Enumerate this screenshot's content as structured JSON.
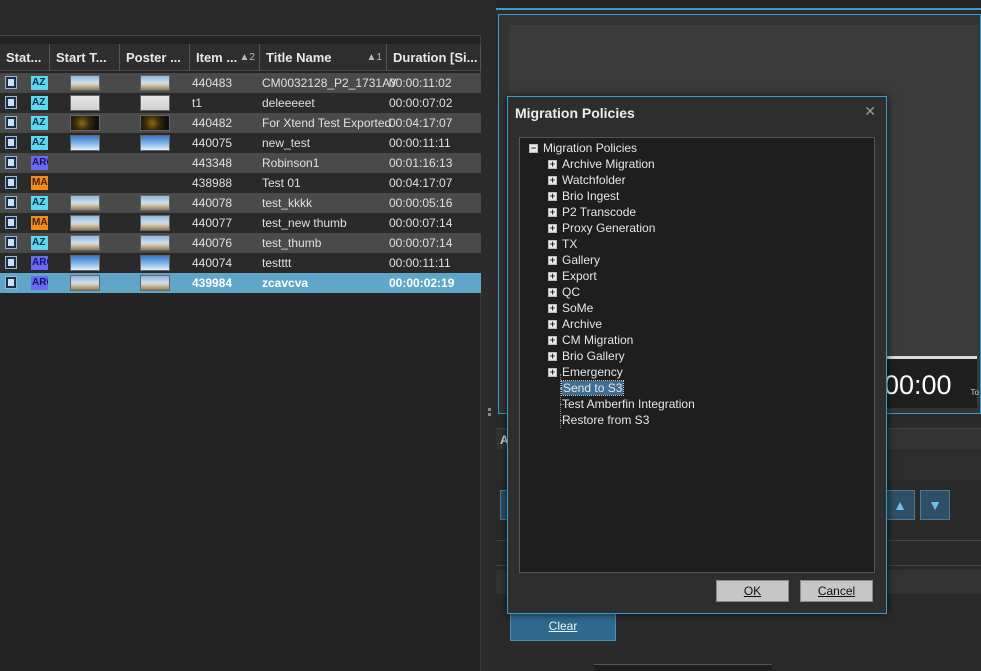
{
  "grid": {
    "columns": [
      {
        "label": "Stat...",
        "sort": ""
      },
      {
        "label": "Start T...",
        "sort": ""
      },
      {
        "label": "Poster ...",
        "sort": ""
      },
      {
        "label": "Item ...",
        "sort": "▲2"
      },
      {
        "label": "Title Name",
        "sort": "▲1"
      },
      {
        "label": "Duration [Si...",
        "sort": ""
      }
    ],
    "rows": [
      {
        "status": "AZ",
        "thumb": "building",
        "item": "440483",
        "title": "CM0032128_P2_1731AY",
        "duration": "00:00:11:02"
      },
      {
        "status": "AZ",
        "thumb": "white",
        "item": "t1",
        "title": "deleeeeet",
        "duration": "00:00:07:02"
      },
      {
        "status": "AZ",
        "thumb": "dark",
        "item": "440482",
        "title": "For Xtend Test Exported",
        "duration": "00:04:17:07"
      },
      {
        "status": "AZ",
        "thumb": "sky",
        "item": "440075",
        "title": "new_test",
        "duration": "00:00:11:11"
      },
      {
        "status": "ARC",
        "thumb": "",
        "item": "443348",
        "title": "Robinson1",
        "duration": "00:01:16:13"
      },
      {
        "status": "MA",
        "thumb": "",
        "item": "438988",
        "title": "Test 01",
        "duration": "00:04:17:07"
      },
      {
        "status": "AZ",
        "thumb": "building",
        "item": "440078",
        "title": "test_kkkk",
        "duration": "00:00:05:16"
      },
      {
        "status": "MA",
        "thumb": "building",
        "item": "440077",
        "title": "test_new thumb",
        "duration": "00:00:07:14"
      },
      {
        "status": "AZ",
        "thumb": "building",
        "item": "440076",
        "title": "test_thumb",
        "duration": "00:00:07:14"
      },
      {
        "status": "ARC",
        "thumb": "sky",
        "item": "440074",
        "title": "testttt",
        "duration": "00:00:11:11"
      },
      {
        "status": "ARC",
        "thumb": "building",
        "item": "439984",
        "title": "zcavcva",
        "duration": "00:00:02:19",
        "selected": true
      }
    ]
  },
  "player": {
    "timecode": "00:00",
    "timecode_suffix": "To",
    "section_label": "A",
    "clear_label": "Clear",
    "up_icon": "arrow-up-icon",
    "down_icon": "arrow-down-icon"
  },
  "dialog": {
    "title": "Migration Policies",
    "close_glyph": "✕",
    "root": "Migration Policies",
    "groups": [
      "Archive Migration",
      "Watchfolder",
      "Brio Ingest",
      "P2 Transcode",
      "Proxy Generation",
      "TX",
      "Gallery",
      "Export",
      "QC",
      "SoMe",
      "Archive",
      "CM Migration",
      "Brio Gallery",
      "Emergency"
    ],
    "leaves": [
      "Send to S3",
      "Test Amberfin Integration",
      "Restore from S3"
    ],
    "selected_leaf": "Send to S3",
    "ok_label": "OK",
    "cancel_label": "Cancel"
  },
  "colors": {
    "accent": "#3a9bd0",
    "selected_row": "#5fa6c8",
    "badge_az": "#5ed8ef",
    "badge_ma": "#f08a1e",
    "badge_arc": "#6a6af0"
  }
}
